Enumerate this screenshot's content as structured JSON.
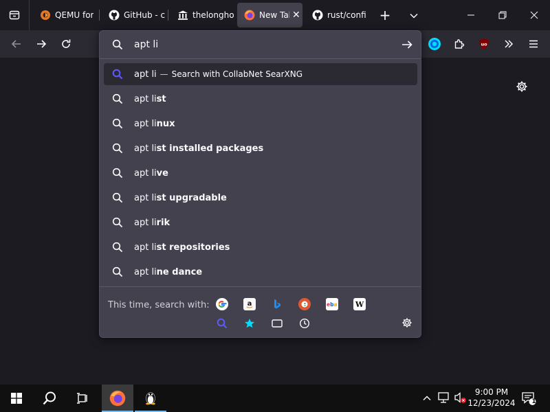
{
  "tabs": [
    {
      "title": "QEMU for",
      "active": false,
      "icon": "qemu-icon"
    },
    {
      "title": "GitHub - c",
      "active": false,
      "icon": "github-icon"
    },
    {
      "title": "thelongho",
      "active": false,
      "icon": "bank-icon"
    },
    {
      "title": "New Tab",
      "active": true,
      "icon": "firefox-icon"
    },
    {
      "title": "rust/confi",
      "active": false,
      "icon": "github-icon"
    }
  ],
  "newtab_label": "+",
  "urlbar": {
    "value": "apt li",
    "typed": "apt li",
    "heuristic": {
      "text": "apt li",
      "separator": "—",
      "action": "Search with CollabNet SearXNG"
    },
    "suggestions": [
      {
        "typed": "apt li",
        "rest": "st"
      },
      {
        "typed": "apt li",
        "rest": "nux"
      },
      {
        "typed": "apt li",
        "rest": "st installed packages"
      },
      {
        "typed": "apt li",
        "rest": "ve"
      },
      {
        "typed": "apt li",
        "rest": "st upgradable"
      },
      {
        "typed": "apt li",
        "rest": "rik"
      },
      {
        "typed": "apt li",
        "rest": "st repositories"
      },
      {
        "typed": "apt li",
        "rest": "ne dance"
      }
    ],
    "oneoff_label": "This time, search with:",
    "engines": [
      "google-icon",
      "amazon-icon",
      "bing-icon",
      "duckduckgo-icon",
      "ebay-icon",
      "wikipedia-icon"
    ],
    "modes": [
      "search-engine-icon",
      "bookmarks-icon",
      "tabs-icon",
      "history-icon"
    ]
  },
  "colors": {
    "accent": "#00ddff",
    "search_highlight": "#5b5bf7",
    "ublock": "#800000"
  },
  "taskbar": {
    "time": "9:00 PM",
    "date": "12/23/2024",
    "notification_count": "1"
  }
}
